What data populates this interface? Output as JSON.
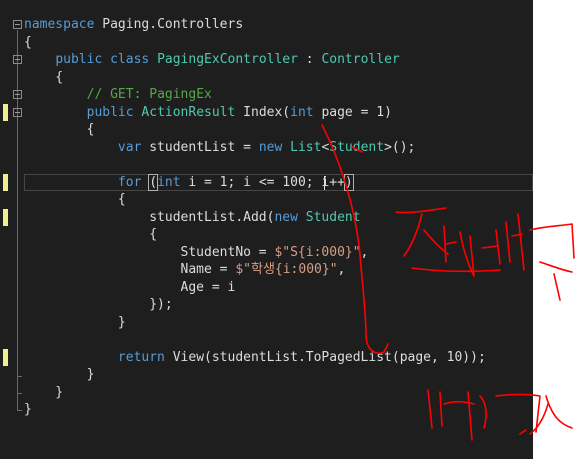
{
  "editor": {
    "lines": [
      {
        "tokens": [
          {
            "t": "namespace",
            "c": "kw"
          },
          {
            "t": " Paging.Controllers",
            "c": ""
          }
        ]
      },
      {
        "tokens": [
          {
            "t": "{",
            "c": ""
          }
        ]
      },
      {
        "tokens": [
          {
            "t": "    ",
            "c": ""
          },
          {
            "t": "public",
            "c": "kw"
          },
          {
            "t": " ",
            "c": ""
          },
          {
            "t": "class",
            "c": "kw"
          },
          {
            "t": " ",
            "c": ""
          },
          {
            "t": "PagingExController",
            "c": "ty"
          },
          {
            "t": " : ",
            "c": ""
          },
          {
            "t": "Controller",
            "c": "ty"
          }
        ]
      },
      {
        "tokens": [
          {
            "t": "    {",
            "c": ""
          }
        ]
      },
      {
        "tokens": [
          {
            "t": "        ",
            "c": ""
          },
          {
            "t": "// GET: PagingEx",
            "c": "cm"
          }
        ]
      },
      {
        "tokens": [
          {
            "t": "        ",
            "c": ""
          },
          {
            "t": "public",
            "c": "kw"
          },
          {
            "t": " ",
            "c": ""
          },
          {
            "t": "ActionResult",
            "c": "ty"
          },
          {
            "t": " Index(",
            "c": ""
          },
          {
            "t": "int",
            "c": "kw"
          },
          {
            "t": " page = 1)",
            "c": ""
          }
        ]
      },
      {
        "tokens": [
          {
            "t": "        {",
            "c": ""
          }
        ]
      },
      {
        "tokens": [
          {
            "t": "            ",
            "c": ""
          },
          {
            "t": "var",
            "c": "kw"
          },
          {
            "t": " studentList = ",
            "c": ""
          },
          {
            "t": "new",
            "c": "kw"
          },
          {
            "t": " ",
            "c": ""
          },
          {
            "t": "List",
            "c": "ty"
          },
          {
            "t": "<",
            "c": ""
          },
          {
            "t": "Student",
            "c": "ty"
          },
          {
            "t": ">();",
            "c": ""
          }
        ]
      },
      {
        "tokens": [
          {
            "t": "",
            "c": ""
          }
        ]
      },
      {
        "tokens": [
          {
            "t": "            ",
            "c": ""
          },
          {
            "t": "for",
            "c": "kw"
          },
          {
            "t": " ",
            "c": ""
          },
          {
            "t": "(",
            "c": "bm"
          },
          {
            "t": "int",
            "c": "kw"
          },
          {
            "t": " i = 1; i <= 100; i++",
            "c": ""
          },
          {
            "t": ")",
            "c": "bm"
          }
        ]
      },
      {
        "tokens": [
          {
            "t": "            {",
            "c": ""
          }
        ]
      },
      {
        "tokens": [
          {
            "t": "                studentList.Add(",
            "c": ""
          },
          {
            "t": "new",
            "c": "kw"
          },
          {
            "t": " ",
            "c": ""
          },
          {
            "t": "Student",
            "c": "ty"
          }
        ]
      },
      {
        "tokens": [
          {
            "t": "                {",
            "c": ""
          }
        ]
      },
      {
        "tokens": [
          {
            "t": "                    StudentNo = ",
            "c": ""
          },
          {
            "t": "$\"S{i:000}\"",
            "c": "st"
          },
          {
            "t": ",",
            "c": ""
          }
        ]
      },
      {
        "tokens": [
          {
            "t": "                    Name = ",
            "c": ""
          },
          {
            "t": "$\"학생{i:000}\"",
            "c": "st"
          },
          {
            "t": ",",
            "c": ""
          }
        ]
      },
      {
        "tokens": [
          {
            "t": "                    Age = i",
            "c": ""
          }
        ]
      },
      {
        "tokens": [
          {
            "t": "                });",
            "c": ""
          }
        ]
      },
      {
        "tokens": [
          {
            "t": "            }",
            "c": ""
          }
        ]
      },
      {
        "tokens": [
          {
            "t": "",
            "c": ""
          }
        ]
      },
      {
        "tokens": [
          {
            "t": "            ",
            "c": ""
          },
          {
            "t": "return",
            "c": "kw"
          },
          {
            "t": " View(studentList.ToPagedList(page, 10));",
            "c": ""
          }
        ]
      },
      {
        "tokens": [
          {
            "t": "        }",
            "c": ""
          }
        ]
      },
      {
        "tokens": [
          {
            "t": "    }",
            "c": ""
          }
        ]
      },
      {
        "tokens": [
          {
            "t": "}",
            "c": ""
          }
        ]
      }
    ],
    "colors": {
      "background": "#1e1e1e",
      "keyword": "#569cd6",
      "type": "#4ec9b0",
      "comment": "#57a64a",
      "string": "#d69d85",
      "text": "#dcdcdc",
      "change_marker": "#efef8c",
      "annotation_ink": "#ff0000"
    },
    "change_marker_lines": [
      5,
      9,
      11,
      19
    ]
  },
  "annotations": {
    "description_icons": [
      "hand-drawn-red-arrow",
      "hand-drawn-red-korean-scribble"
    ]
  }
}
